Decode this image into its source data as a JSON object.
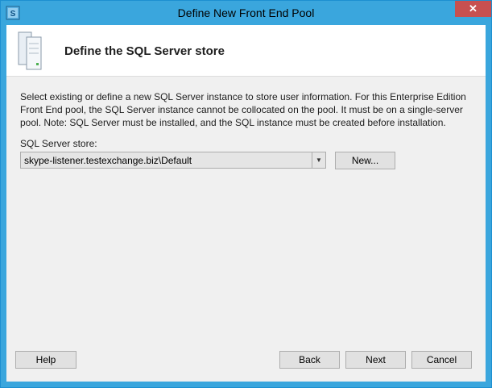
{
  "window": {
    "title": "Define New Front End Pool",
    "close_label": "✕"
  },
  "header": {
    "title": "Define the SQL Server store"
  },
  "description": "Select existing or define a new SQL Server instance to store user information.  For this Enterprise Edition Front End pool, the SQL Server instance cannot be collocated on the pool. It must be on a single-server pool.  Note: SQL Server must be installed, and the SQL instance must be created before installation.",
  "store": {
    "label": "SQL Server store:",
    "selected_value": "skype-listener.testexchange.biz\\Default",
    "new_label": "New..."
  },
  "footer": {
    "help_label": "Help",
    "back_label": "Back",
    "next_label": "Next",
    "cancel_label": "Cancel"
  },
  "icons": {
    "app": "skype-for-business-icon",
    "header": "server-stack-icon",
    "dropdown": "chevron-down-icon"
  },
  "colors": {
    "titlebar": "#3aa6dd",
    "close_button": "#c75050",
    "dialog_background": "#f0f0f0"
  }
}
